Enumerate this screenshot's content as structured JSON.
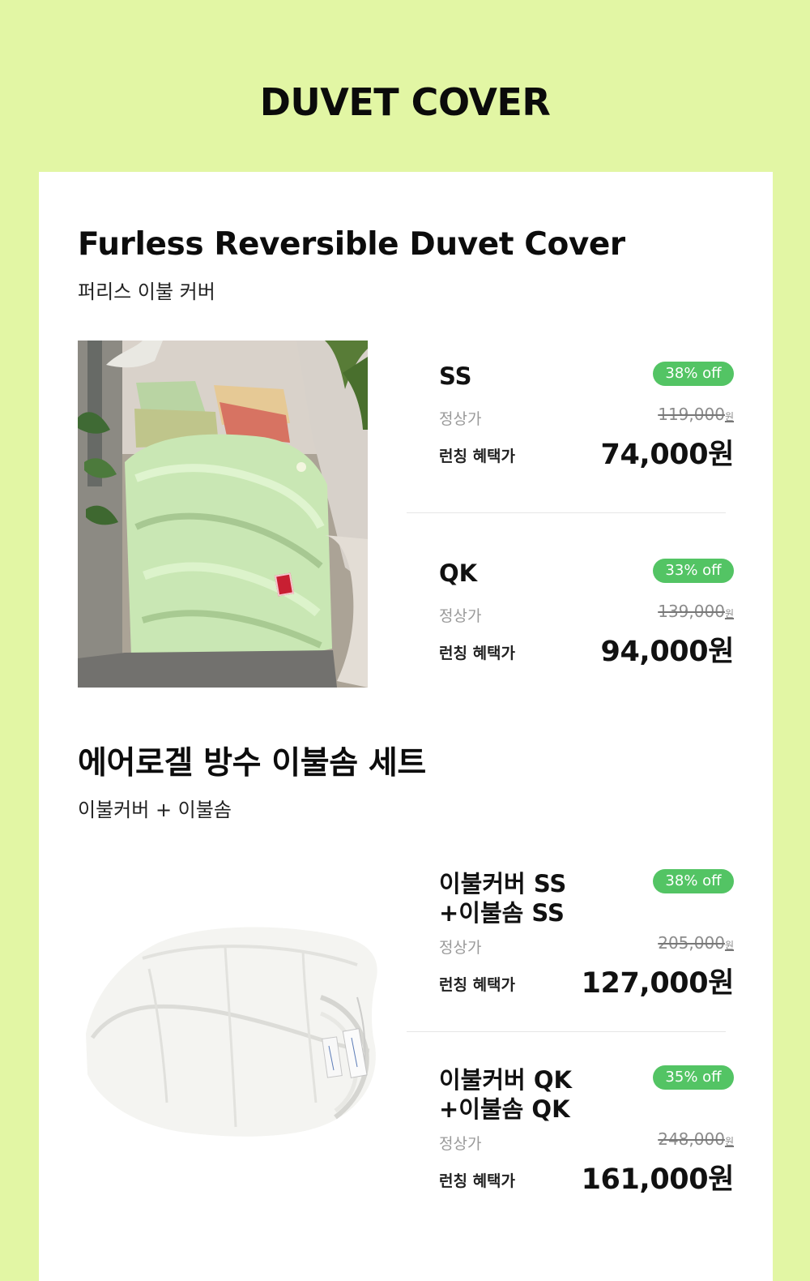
{
  "page": {
    "title": "DUVET COVER"
  },
  "colors": {
    "background": "#e2f6a4",
    "card": "#ffffff",
    "badge": "#53c464"
  },
  "sections": [
    {
      "title": "Furless Reversible Duvet Cover",
      "subtitle": "퍼리스 이불 커버",
      "image": "green-duvet-bed-photo",
      "options": [
        {
          "name_line1": "SS",
          "name_line2": "",
          "discount": "38% off",
          "regular_label": "정상가",
          "regular_price": "119,000",
          "regular_unit": "원",
          "benefit_label": "런칭 혜택가",
          "sale_price": "74,000원"
        },
        {
          "name_line1": "QK",
          "name_line2": "",
          "discount": "33% off",
          "regular_label": "정상가",
          "regular_price": "139,000",
          "regular_unit": "원",
          "benefit_label": "런칭 혜택가",
          "sale_price": "94,000원"
        }
      ]
    },
    {
      "title": "에어로겔 방수 이불솜 세트",
      "subtitle": "이불커버 + 이불솜",
      "image": "white-comforter-photo",
      "options": [
        {
          "name_line1": "이불커버 SS",
          "name_line2": "+이불솜 SS",
          "discount": "38% off",
          "regular_label": "정상가",
          "regular_price": "205,000",
          "regular_unit": "원",
          "benefit_label": "런칭 혜택가",
          "sale_price": "127,000원"
        },
        {
          "name_line1": "이불커버 QK",
          "name_line2": "+이불솜 QK",
          "discount": "35% off",
          "regular_label": "정상가",
          "regular_price": "248,000",
          "regular_unit": "원",
          "benefit_label": "런칭 혜택가",
          "sale_price": "161,000원"
        }
      ]
    }
  ]
}
